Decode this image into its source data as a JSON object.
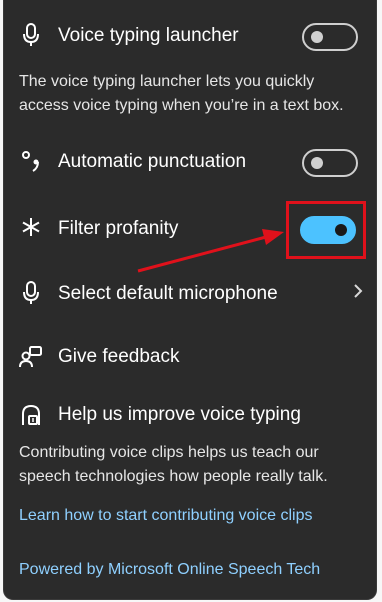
{
  "voice_launcher": {
    "label": "Voice typing launcher",
    "toggle_on": false,
    "description_line1": "The voice typing launcher lets you quickly",
    "description_line2": "access voice typing when you’re in a text box."
  },
  "auto_punctuation": {
    "label": "Automatic punctuation",
    "toggle_on": false
  },
  "filter_profanity": {
    "label": "Filter profanity",
    "toggle_on": true
  },
  "microphone": {
    "label": "Select default microphone"
  },
  "feedback": {
    "label": "Give feedback"
  },
  "improve": {
    "label": "Help us improve voice typing",
    "description_line1": "Contributing voice clips helps us teach our",
    "description_line2": "speech technologies how people really talk.",
    "link": "Learn how to start contributing voice clips"
  },
  "footer": {
    "powered_by": "Powered by Microsoft Online Speech Tech"
  },
  "colors": {
    "panel_bg": "#2b2b2b",
    "accent": "#4cc2ff",
    "link": "#8fd0ff",
    "annotation": "#e0111b"
  },
  "icons": {
    "voice_launcher": "microphone-icon",
    "auto_punctuation": "punctuation-icon",
    "filter_profanity": "asterisk-icon",
    "microphone": "microphone-icon",
    "feedback": "feedback-icon",
    "improve": "voice-clip-icon",
    "microphone_arrow": "chevron-right-icon"
  }
}
